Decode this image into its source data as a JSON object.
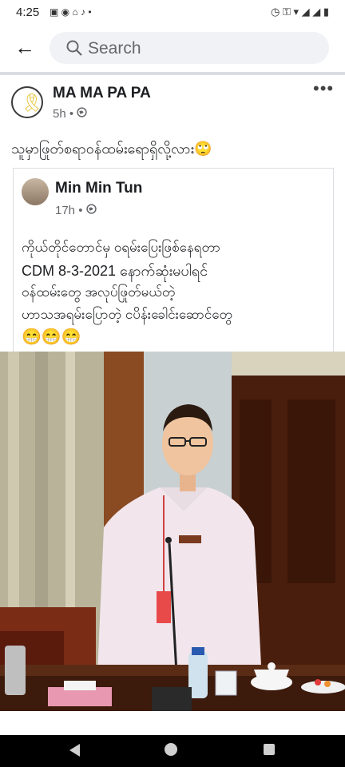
{
  "status_bar": {
    "time": "4:25",
    "left_icons": "▣ ◉ ⌂ ♪ •",
    "right_icons": "◷ ⚿ ▾ ◢ ◢ ▮"
  },
  "search": {
    "placeholder": "Search"
  },
  "post": {
    "author": "MA MA PA PA",
    "time": "5h •",
    "text": "သူမှာဖြုတ်စရာဝန်ထမ်းရောရှိလို့လား🙄",
    "more": "•••"
  },
  "shared": {
    "author": "Min Min Tun",
    "time": "17h •",
    "lines": [
      "ကိုယ်တိုင်တောင်မှ ဝရမ်းပြေးဖြစ်နေရတာ",
      "CDM 8-3-2021 နောက်ဆုံးမပါရင်",
      "ဝန်ထမ်းတွေ အလုပ်ဖြုတ်မယ်တဲ့",
      "ဟာသအရမ်းပြောတဲ့ ငပိန်းခေါင်းဆောင်တွေ"
    ],
    "emojis": "😁😁😁"
  },
  "icons": {
    "back": "back-arrow-icon",
    "search": "search-icon",
    "ribbon": "ribbon-icon",
    "globe": "globe-icon",
    "more": "more-icon"
  }
}
